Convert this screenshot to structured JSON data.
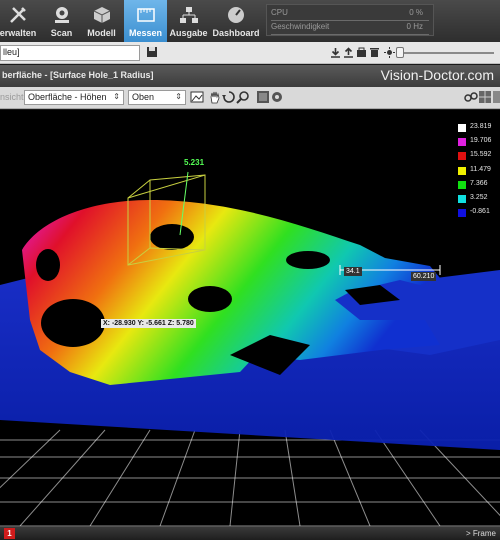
{
  "ribbon": {
    "buttons": [
      {
        "label": "erwalten",
        "icon": "tools-icon"
      },
      {
        "label": "Scan",
        "icon": "scan-icon"
      },
      {
        "label": "Modell",
        "icon": "cube-icon"
      },
      {
        "label": "Messen",
        "icon": "measure-icon",
        "active": true
      },
      {
        "label": "Ausgabe",
        "icon": "network-icon"
      },
      {
        "label": "Dashboard",
        "icon": "gauge-icon"
      }
    ],
    "status": {
      "cpu_label": "CPU",
      "cpu_value": "0 %",
      "speed_label": "Geschwindigkeit",
      "speed_value": "0 Hz"
    }
  },
  "toolbar2": {
    "file_value": "lleu]",
    "slider_level": 0.0
  },
  "panel": {
    "title": "berfläche - [Surface Hole_1 Radius]",
    "brand": "Vision-Doctor.com"
  },
  "viewbar": {
    "label": "nsicht",
    "mode_select": "Oberfläche - Höhen",
    "view_select": "Oben"
  },
  "legend": [
    {
      "value": "23.819",
      "color": "#ffffff"
    },
    {
      "value": "19.706",
      "color": "#e020e0"
    },
    {
      "value": "15.592",
      "color": "#e01010"
    },
    {
      "value": "11.479",
      "color": "#f0f000"
    },
    {
      "value": "7.366",
      "color": "#10e010"
    },
    {
      "value": "3.252",
      "color": "#10e0e0"
    },
    {
      "value": "-0.861",
      "color": "#1010e0"
    }
  ],
  "annotations": {
    "height_value": "5.231",
    "coord_readout": "X: -28.930 Y: -5.661 Z: 5.780",
    "dim_a": "34.1",
    "dim_b": "60.210"
  },
  "bottom": {
    "error_count": "1",
    "frame_label": "> Frame"
  }
}
